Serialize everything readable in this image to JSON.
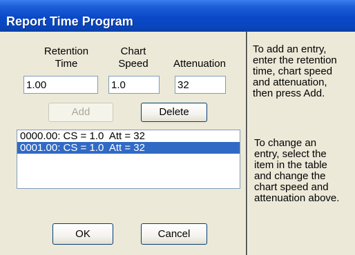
{
  "window": {
    "title": "Report Time Program"
  },
  "fields": {
    "retention_label_1": "Retention",
    "retention_label_2": "Time",
    "retention_value": "1.00",
    "speed_label_1": "Chart",
    "speed_label_2": "Speed",
    "speed_value": "1.0",
    "attenuation_label": "Attenuation",
    "attenuation_value": "32"
  },
  "buttons": {
    "add": "Add",
    "delete": "Delete",
    "ok": "OK",
    "cancel": "Cancel"
  },
  "list": {
    "items": [
      {
        "text": "0000.00: CS = 1.0  Att = 32",
        "selected": false
      },
      {
        "text": "0001.00: CS = 1.0  Att = 32",
        "selected": true
      }
    ]
  },
  "help": {
    "add_lines": [
      "To add an entry,",
      "enter the retention",
      "time, chart speed",
      "and attenuation,",
      "then press Add."
    ],
    "change_lines": [
      "To change an",
      "entry, select the",
      "item in the table",
      "and change the",
      "chart speed and",
      "attenuation above."
    ]
  }
}
